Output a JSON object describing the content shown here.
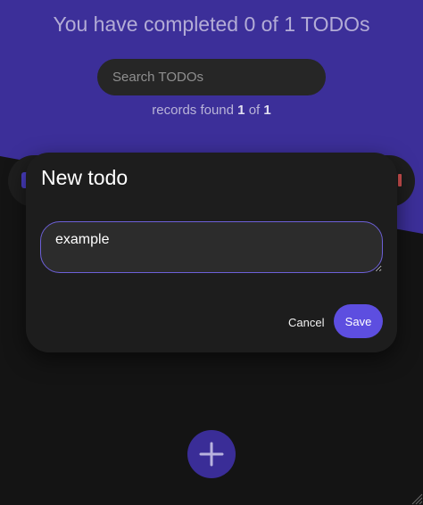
{
  "header": {
    "heading": "You have completed 0 of 1 TODOs"
  },
  "search": {
    "placeholder": "Search TODOs",
    "value": ""
  },
  "records": {
    "prefix": "records found",
    "found": "1",
    "of_word": "of",
    "total": "1"
  },
  "dialog": {
    "title": "New todo",
    "input_value": "example",
    "cancel_label": "Cancel",
    "save_label": "Save"
  },
  "fab": {
    "icon": "plus-icon"
  },
  "colors": {
    "hero_background": "#3c2f99",
    "page_background": "#141414",
    "accent": "#5d4ee0",
    "dialog_background": "#1d1d1d",
    "input_border": "#6d60d8",
    "delete_icon": "#d65252"
  }
}
